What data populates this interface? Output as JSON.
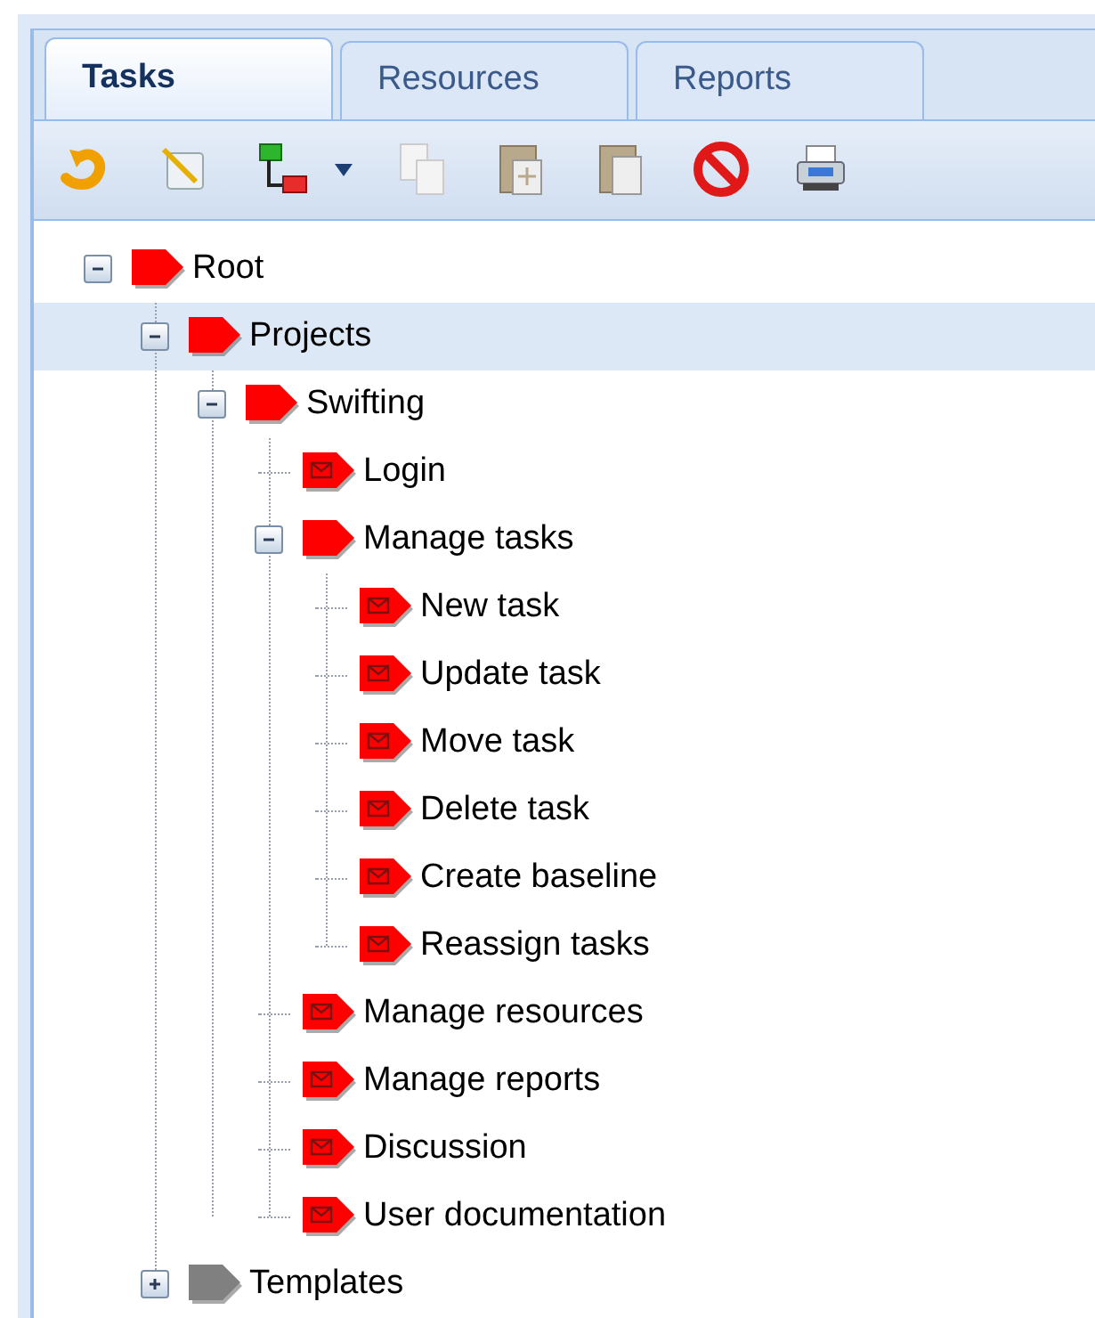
{
  "tabs": [
    {
      "label": "Tasks",
      "selected": true
    },
    {
      "label": "Resources",
      "selected": false
    },
    {
      "label": "Reports",
      "selected": false
    }
  ],
  "tree": [
    {
      "label": "Root",
      "kind": "folder",
      "color": "#ff0000",
      "expanded": true,
      "selected": false,
      "children": [
        {
          "label": "Projects",
          "kind": "folder",
          "color": "#ff0000",
          "expanded": true,
          "selected": true,
          "children": [
            {
              "label": "Swifting",
              "kind": "folder",
              "color": "#ff0000",
              "expanded": true,
              "selected": false,
              "children": [
                {
                  "label": "Login",
                  "kind": "task",
                  "color": "#ff0000",
                  "selected": false
                },
                {
                  "label": "Manage tasks",
                  "kind": "folder",
                  "color": "#ff0000",
                  "expanded": true,
                  "selected": false,
                  "children": [
                    {
                      "label": "New task",
                      "kind": "task",
                      "color": "#ff0000",
                      "selected": false
                    },
                    {
                      "label": "Update task",
                      "kind": "task",
                      "color": "#ff0000",
                      "selected": false
                    },
                    {
                      "label": "Move task",
                      "kind": "task",
                      "color": "#ff0000",
                      "selected": false
                    },
                    {
                      "label": "Delete task",
                      "kind": "task",
                      "color": "#ff0000",
                      "selected": false
                    },
                    {
                      "label": "Create baseline",
                      "kind": "task",
                      "color": "#ff0000",
                      "selected": false
                    },
                    {
                      "label": "Reassign tasks",
                      "kind": "task",
                      "color": "#ff0000",
                      "selected": false
                    }
                  ]
                },
                {
                  "label": "Manage resources",
                  "kind": "task",
                  "color": "#ff0000",
                  "selected": false
                },
                {
                  "label": "Manage reports",
                  "kind": "task",
                  "color": "#ff0000",
                  "selected": false
                },
                {
                  "label": "Discussion",
                  "kind": "task",
                  "color": "#ff0000",
                  "selected": false
                },
                {
                  "label": "User documentation",
                  "kind": "task",
                  "color": "#ff0000",
                  "selected": false
                }
              ]
            }
          ]
        },
        {
          "label": "Templates",
          "kind": "folder",
          "color": "#808080",
          "expanded": false,
          "selected": false
        }
      ]
    }
  ]
}
